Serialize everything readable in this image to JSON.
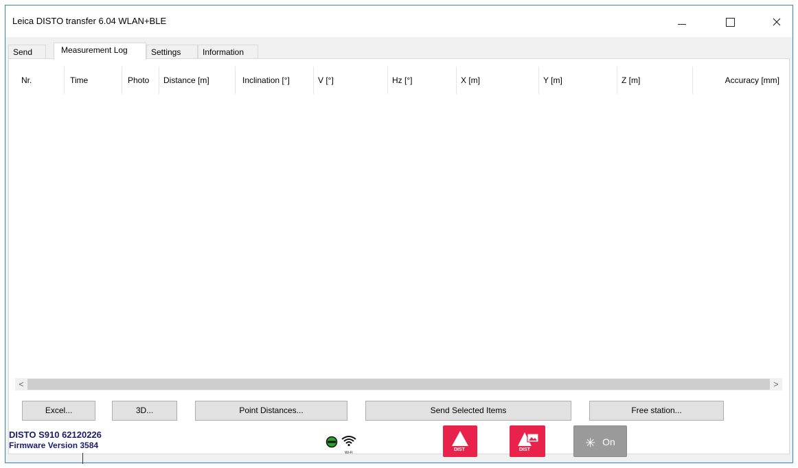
{
  "window": {
    "title": "Leica DISTO transfer 6.04 WLAN+BLE",
    "minimize_icon": "minimize-icon",
    "maximize_icon": "maximize-icon",
    "close_icon": "close-icon"
  },
  "tabs": [
    {
      "label": "Send",
      "active": false
    },
    {
      "label": "Measurement Log",
      "active": true
    },
    {
      "label": "Settings",
      "active": false
    },
    {
      "label": "Information",
      "active": false
    }
  ],
  "table": {
    "columns": [
      "Nr.",
      "Time",
      "Photo",
      "Distance [m]",
      "Inclination [°]",
      "V [°]",
      "Hz [°]",
      "X [m]",
      "Y [m]",
      "Z [m]",
      "Accuracy [mm]"
    ],
    "rows": []
  },
  "buttons": {
    "excel": "Excel...",
    "threed": "3D...",
    "point_distances": "Point Distances...",
    "send_selected": "Send Selected Items",
    "free_station": "Free station..."
  },
  "status": {
    "device": "DISTO S910 62120226",
    "firmware": "Firmware Version 3584",
    "icons": [
      "connection-status-icon",
      "wifi-icon"
    ],
    "wifi_caption": "Wi-Fi",
    "dist_label": "DIST",
    "on_label": "On"
  },
  "colors": {
    "accent_red": "#e8224a",
    "device_text": "#1a1a6e",
    "status_green": "#2aa12a"
  }
}
